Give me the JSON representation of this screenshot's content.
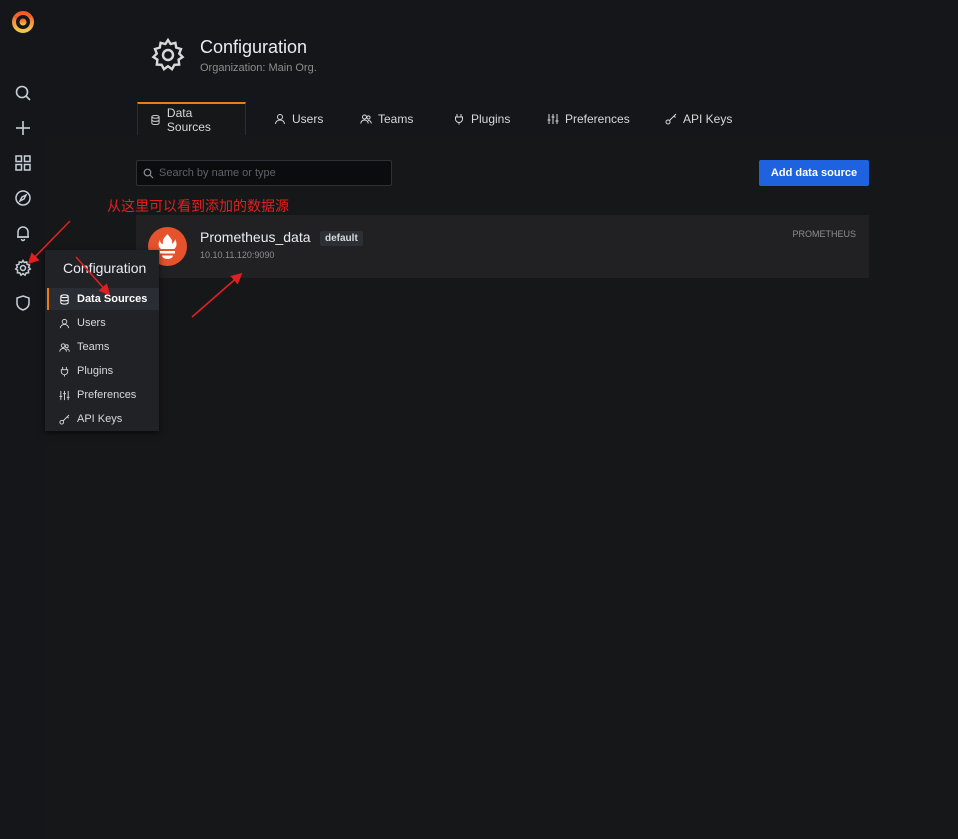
{
  "header": {
    "title": "Configuration",
    "subtitle": "Organization: Main Org."
  },
  "tabs": [
    {
      "label": "Data Sources",
      "icon": "database-icon",
      "active": true
    },
    {
      "label": "Users",
      "icon": "user-icon"
    },
    {
      "label": "Teams",
      "icon": "users-icon"
    },
    {
      "label": "Plugins",
      "icon": "plug-icon"
    },
    {
      "label": "Preferences",
      "icon": "sliders-icon"
    },
    {
      "label": "API Keys",
      "icon": "key-icon"
    }
  ],
  "search": {
    "placeholder": "Search by name or type"
  },
  "add_button": {
    "label": "Add data source"
  },
  "annotation": {
    "text": "从这里可以看到添加的数据源",
    "color": "#e02020"
  },
  "datasource": {
    "name": "Prometheus_data",
    "badge": "default",
    "url": "10.10.11.120:9090",
    "type": "PROMETHEUS"
  },
  "dropdown": {
    "header": "Configuration",
    "items": [
      {
        "label": "Data Sources",
        "icon": "database-icon",
        "active": true
      },
      {
        "label": "Users",
        "icon": "user-icon"
      },
      {
        "label": "Teams",
        "icon": "users-icon"
      },
      {
        "label": "Plugins",
        "icon": "plug-icon"
      },
      {
        "label": "Preferences",
        "icon": "sliders-icon"
      },
      {
        "label": "API Keys",
        "icon": "key-icon"
      }
    ]
  },
  "sidebar": {
    "icons": [
      "grafana-logo",
      "search-icon",
      "plus-icon",
      "dashboards-icon",
      "explore-icon",
      "bell-icon",
      "gear-icon",
      "shield-icon"
    ]
  },
  "colors": {
    "accent": "#eb7b18",
    "primary_button": "#1f62e0",
    "background": "#161719"
  }
}
